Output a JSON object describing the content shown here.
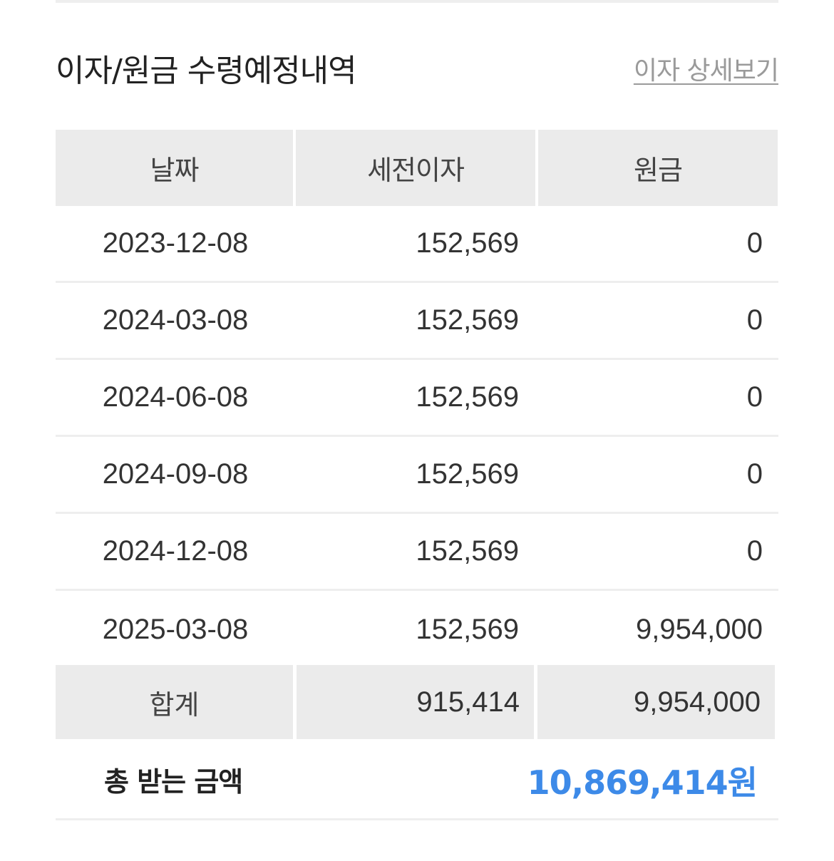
{
  "section": {
    "title": "이자/원금 수령예정내역",
    "detail_link": "이자 상세보기"
  },
  "table": {
    "headers": [
      "날짜",
      "세전이자",
      "원금"
    ],
    "rows": [
      {
        "date": "2023-12-08",
        "interest": "152,569",
        "principal": "0"
      },
      {
        "date": "2024-03-08",
        "interest": "152,569",
        "principal": "0"
      },
      {
        "date": "2024-06-08",
        "interest": "152,569",
        "principal": "0"
      },
      {
        "date": "2024-09-08",
        "interest": "152,569",
        "principal": "0"
      },
      {
        "date": "2024-12-08",
        "interest": "152,569",
        "principal": "0"
      },
      {
        "date": "2025-03-08",
        "interest": "152,569",
        "principal": "9,954,000"
      }
    ],
    "sum": {
      "label": "합계",
      "interest": "915,414",
      "principal": "9,954,000"
    }
  },
  "total": {
    "label": "총 받는 금액",
    "amount": "10,869,414",
    "unit": "원"
  },
  "colors": {
    "accent": "#3d8ae8",
    "header_bg": "#ebebeb",
    "divider": "#eeeeee",
    "link": "#9a9a9a"
  }
}
